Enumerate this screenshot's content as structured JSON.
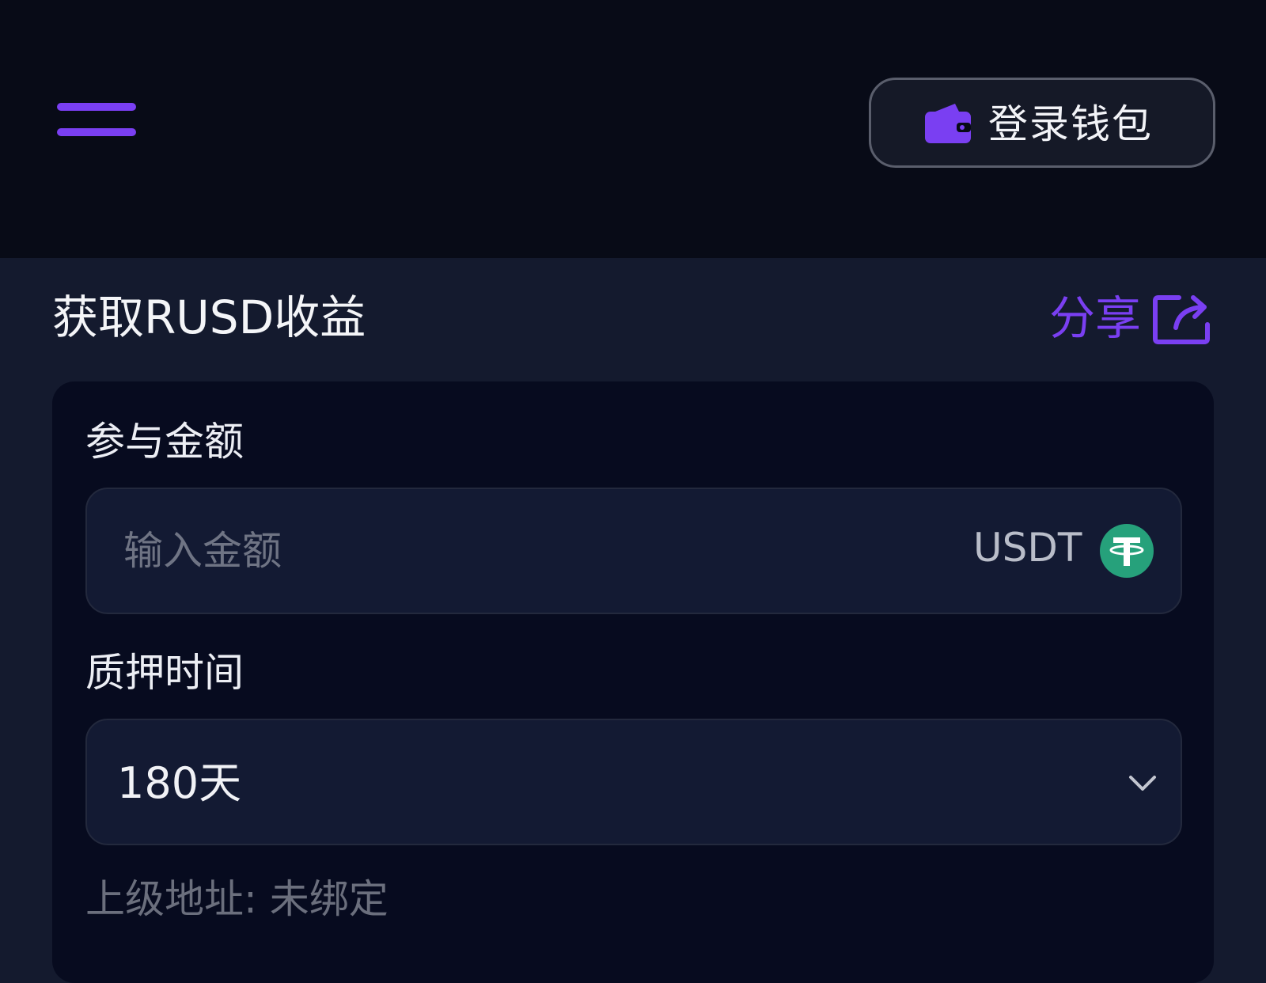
{
  "header": {
    "wallet_button_label": "登录钱包"
  },
  "section": {
    "title": "获取RUSD收益",
    "share_label": "分享"
  },
  "form": {
    "amount_label": "参与金额",
    "amount_value": "",
    "amount_placeholder": "输入金额",
    "currency": "USDT",
    "duration_label": "质押时间",
    "duration_value": "180天",
    "referrer_text": "上级地址: 未绑定"
  },
  "colors": {
    "accent": "#7a3ff2",
    "usdt_green": "#26a17b",
    "header_background": "#080b17",
    "page_background": "#141a2e",
    "card_background": "#070b1f"
  },
  "icons": {
    "menu": "hamburger-menu-icon",
    "wallet": "wallet-icon",
    "share": "share-icon",
    "currency": "usdt-tether-icon",
    "dropdown": "chevron-down-icon"
  }
}
